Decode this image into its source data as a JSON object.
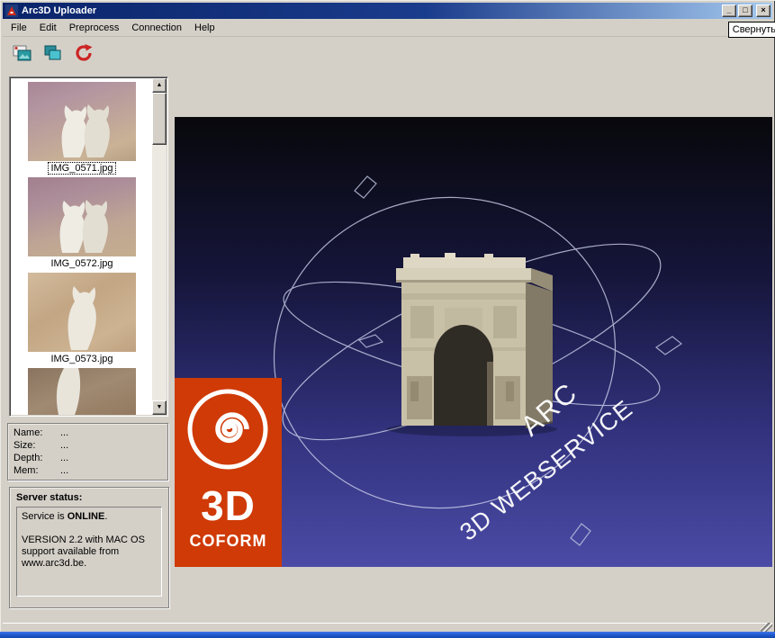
{
  "window": {
    "title": "Arc3D Uploader",
    "controls": {
      "minimize": "_",
      "maximize": "□",
      "close": "×"
    }
  },
  "tooltip": {
    "text": "Свернуть"
  },
  "menu": {
    "items": [
      {
        "label": "File"
      },
      {
        "label": "Edit"
      },
      {
        "label": "Preprocess"
      },
      {
        "label": "Connection"
      },
      {
        "label": "Help"
      }
    ]
  },
  "toolbar": {
    "buttons": [
      {
        "name": "add-images-icon"
      },
      {
        "name": "duplicate-images-icon"
      },
      {
        "name": "process-refresh-icon"
      }
    ]
  },
  "thumbnail_list": {
    "items": [
      {
        "label": "IMG_0571.jpg",
        "selected": true
      },
      {
        "label": "IMG_0572.jpg",
        "selected": false
      },
      {
        "label": "IMG_0573.jpg",
        "selected": false
      },
      {
        "label": "",
        "partial": true
      }
    ],
    "scroll_icons": {
      "up": "▲",
      "down": "▼"
    }
  },
  "info_panel": {
    "rows": [
      {
        "label": "Name:",
        "value": "..."
      },
      {
        "label": "Size:",
        "value": "..."
      },
      {
        "label": "Depth:",
        "value": "..."
      },
      {
        "label": "Mem:",
        "value": "..."
      }
    ]
  },
  "server_status": {
    "heading": "Server status:",
    "service_prefix": "Service is ",
    "service_state": "ONLINE",
    "service_suffix": ".",
    "version_text": "VERSION 2.2 with MAC OS support available from www.arc3d.be."
  },
  "viewport": {
    "arc_label": "ARC",
    "webservice_label": "3D WEBSERVICE"
  },
  "logo": {
    "big_text": "3D",
    "sub_text": "COFORM"
  },
  "colors": {
    "titlebar_left": "#0a246a",
    "titlebar_right": "#a6caf0",
    "window_face": "#d4d0c8",
    "logo_orange": "#cf3a06",
    "viewport_top": "#08080c",
    "viewport_bottom": "#4b4ba6",
    "taskbar_blue": "#1d55c8"
  }
}
